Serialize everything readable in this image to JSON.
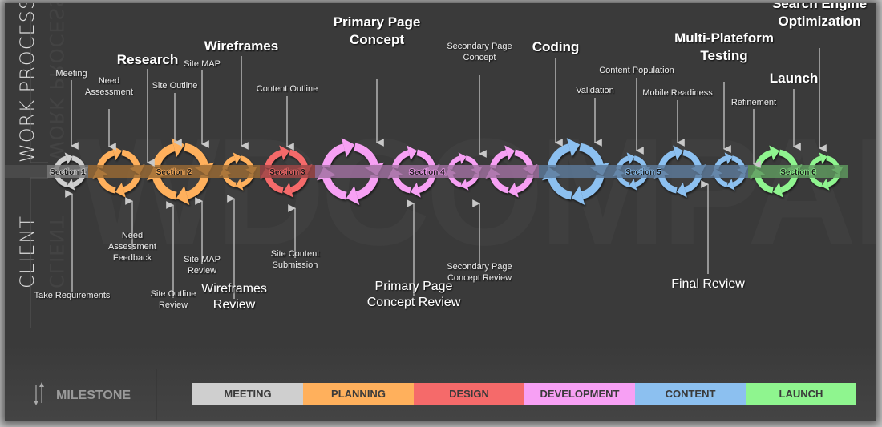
{
  "side_labels": {
    "top": "WORK PROCESS",
    "bottom": "CLIENT"
  },
  "watermark": "WDCOMPANYZ",
  "phases": [
    {
      "key": "meeting",
      "label": "MEETING",
      "color": "#cfcfcf"
    },
    {
      "key": "planning",
      "label": "PLANNING",
      "color": "#ffb05c"
    },
    {
      "key": "design",
      "label": "DESIGN",
      "color": "#f56a6a"
    },
    {
      "key": "development",
      "label": "DEVELOPMENT",
      "color": "#f7a0f4"
    },
    {
      "key": "content",
      "label": "CONTENT",
      "color": "#8cc0f0"
    },
    {
      "key": "launch",
      "label": "LAUNCH",
      "color": "#8ff58f"
    }
  ],
  "sections": [
    {
      "label": "Section 1",
      "phase": "meeting"
    },
    {
      "label": "Section 2",
      "phase": "planning"
    },
    {
      "label": "Section 3",
      "phase": "design"
    },
    {
      "label": "Section 4",
      "phase": "development"
    },
    {
      "label": "Section 5",
      "phase": "content"
    },
    {
      "label": "Section 6",
      "phase": "launch"
    }
  ],
  "cycles": [
    {
      "phase": "meeting",
      "size": "small"
    },
    {
      "phase": "planning",
      "size": "medium"
    },
    {
      "phase": "planning",
      "size": "large"
    },
    {
      "phase": "planning",
      "size": "small"
    },
    {
      "phase": "design",
      "size": "medium"
    },
    {
      "phase": "development",
      "size": "large"
    },
    {
      "phase": "development",
      "size": "medium"
    },
    {
      "phase": "development",
      "size": "small"
    },
    {
      "phase": "development",
      "size": "medium"
    },
    {
      "phase": "content",
      "size": "large"
    },
    {
      "phase": "content",
      "size": "small"
    },
    {
      "phase": "content",
      "size": "medium"
    },
    {
      "phase": "content",
      "size": "small"
    },
    {
      "phase": "launch",
      "size": "medium"
    },
    {
      "phase": "launch",
      "size": "small"
    }
  ],
  "work_process_milestones": [
    {
      "lines": [
        "Meeting"
      ],
      "weight": "small"
    },
    {
      "lines": [
        "Need",
        "Assessment"
      ],
      "weight": "small"
    },
    {
      "lines": [
        "Research"
      ],
      "weight": "big"
    },
    {
      "lines": [
        "Site Outline"
      ],
      "weight": "small"
    },
    {
      "lines": [
        "Site MAP"
      ],
      "weight": "small"
    },
    {
      "lines": [
        "Wireframes"
      ],
      "weight": "big"
    },
    {
      "lines": [
        "Content Outline"
      ],
      "weight": "small"
    },
    {
      "lines": [
        "Primary Page",
        "Concept"
      ],
      "weight": "big"
    },
    {
      "lines": [
        "Secondary Page",
        "Concept"
      ],
      "weight": "small"
    },
    {
      "lines": [
        "Coding"
      ],
      "weight": "big"
    },
    {
      "lines": [
        "Validation"
      ],
      "weight": "small"
    },
    {
      "lines": [
        "Content Population"
      ],
      "weight": "small"
    },
    {
      "lines": [
        "Mobile Readiness"
      ],
      "weight": "small"
    },
    {
      "lines": [
        "Multi-Plateform",
        "Testing"
      ],
      "weight": "big"
    },
    {
      "lines": [
        "Refinement"
      ],
      "weight": "small"
    },
    {
      "lines": [
        "Launch"
      ],
      "weight": "big"
    },
    {
      "lines": [
        "Search Engine",
        "Optimization"
      ],
      "weight": "big"
    }
  ],
  "client_milestones": [
    {
      "lines": [
        "Take Requirements"
      ],
      "weight": "small"
    },
    {
      "lines": [
        "Need",
        "Assessment",
        "Feedback"
      ],
      "weight": "small"
    },
    {
      "lines": [
        "Site Outline",
        "Review"
      ],
      "weight": "small"
    },
    {
      "lines": [
        "Site MAP",
        "Review"
      ],
      "weight": "small"
    },
    {
      "lines": [
        "Wireframes",
        "Review"
      ],
      "weight": "mid"
    },
    {
      "lines": [
        "Site Content",
        "Submission"
      ],
      "weight": "small"
    },
    {
      "lines": [
        "Primary Page",
        "Concept Review"
      ],
      "weight": "mid"
    },
    {
      "lines": [
        "Secondary Page",
        "Concept Review"
      ],
      "weight": "small"
    },
    {
      "lines": [
        "Final Review"
      ],
      "weight": "mid"
    }
  ],
  "legend": {
    "milestone_label": "MILESTONE",
    "milestone_icon": "up-down-arrows-icon"
  }
}
